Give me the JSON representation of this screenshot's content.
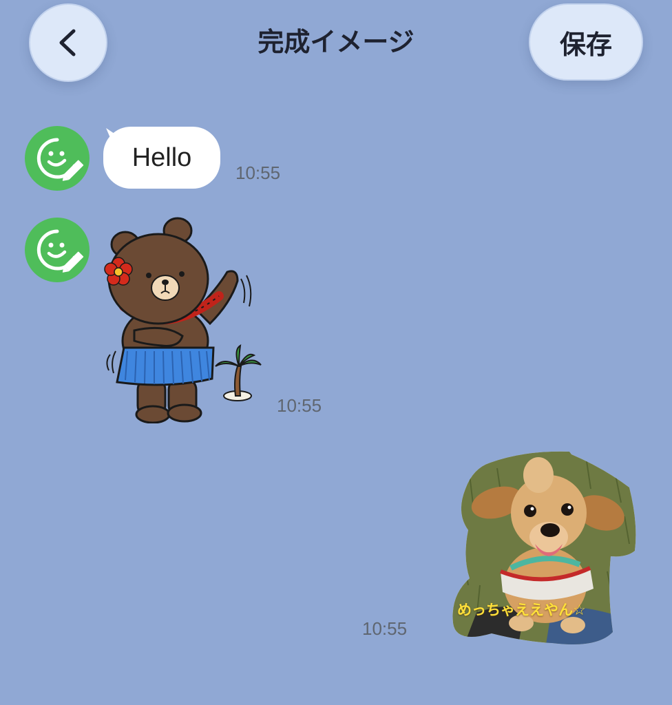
{
  "header": {
    "title": "完成イメージ",
    "save_label": "保存",
    "back_icon": "chevron-left-icon"
  },
  "messages": [
    {
      "type": "text",
      "sender": "other",
      "text": "Hello",
      "time": "10:55",
      "avatar_icon": "sticker-maker-smiley-pencil-icon"
    },
    {
      "type": "sticker",
      "sender": "other",
      "time": "10:55",
      "avatar_icon": "sticker-maker-smiley-pencil-icon",
      "sticker": "brown-bear-hula-sticker"
    },
    {
      "type": "photo-sticker",
      "sender": "self",
      "time": "10:55",
      "caption": "めっちゃええやん☆",
      "sticker": "dachshund-photo-sticker"
    }
  ],
  "colors": {
    "background": "#90a8d4",
    "button_bg": "#dde8f9",
    "avatar_green": "#4fbd5a",
    "caption_yellow": "#ffe03a"
  }
}
